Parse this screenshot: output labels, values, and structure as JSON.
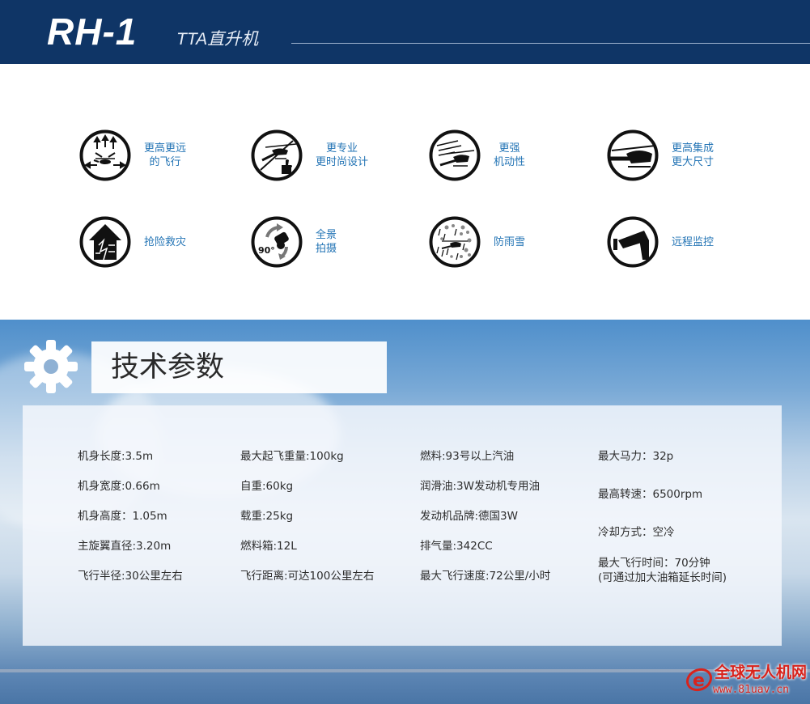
{
  "header": {
    "model": "RH-1",
    "subtitle": "TTA直升机"
  },
  "features": [
    {
      "icon": "arrows-helicopter-icon",
      "lines": [
        "更高更远",
        "的飞行"
      ]
    },
    {
      "icon": "helicopter-thumbs-up-icon",
      "lines": [
        "更专业",
        "更时尚设计"
      ]
    },
    {
      "icon": "helicopter-speed-icon",
      "lines": [
        "更强",
        "机动性"
      ]
    },
    {
      "icon": "large-helicopter-icon",
      "lines": [
        "更高集成",
        "更大尺寸"
      ]
    },
    {
      "icon": "rescue-house-icon",
      "lines": [
        "抢险救灾"
      ]
    },
    {
      "icon": "rotate-camera-icon",
      "badge": "90°",
      "lines": [
        "全景",
        "拍摄"
      ]
    },
    {
      "icon": "rain-snow-helicopter-icon",
      "lines": [
        "防雨雪"
      ]
    },
    {
      "icon": "surveillance-camera-icon",
      "lines": [
        "远程监控"
      ]
    }
  ],
  "tech": {
    "title": "技术参数",
    "specs": {
      "col1": [
        "机身长度:3.5m",
        "机身宽度:0.66m",
        "机身高度：1.05m",
        "主旋翼直径:3.20m",
        "飞行半径:30公里左右"
      ],
      "col2": [
        "最大起飞重量:100kg",
        "自重:60kg",
        "载重:25kg",
        "燃料箱:12L",
        "飞行距离:可达100公里左右"
      ],
      "col3": [
        "燃料:93号以上汽油",
        "润滑油:3W发动机专用油",
        "发动机品牌:德国3W",
        "排气量:342CC",
        "最大飞行速度:72公里/小时"
      ],
      "col4": [
        "最大马力：32p",
        "最高转速：6500rpm",
        "冷却方式：空冷",
        "最大飞行时间：70分钟",
        "(可通过加大油箱延长时间)"
      ]
    }
  },
  "watermark": {
    "name": "全球无人机网",
    "url": "www.81uav.cn"
  },
  "colors": {
    "header_bg": "#0f3566",
    "feature_text": "#2374b5",
    "watermark": "#d8231c"
  }
}
